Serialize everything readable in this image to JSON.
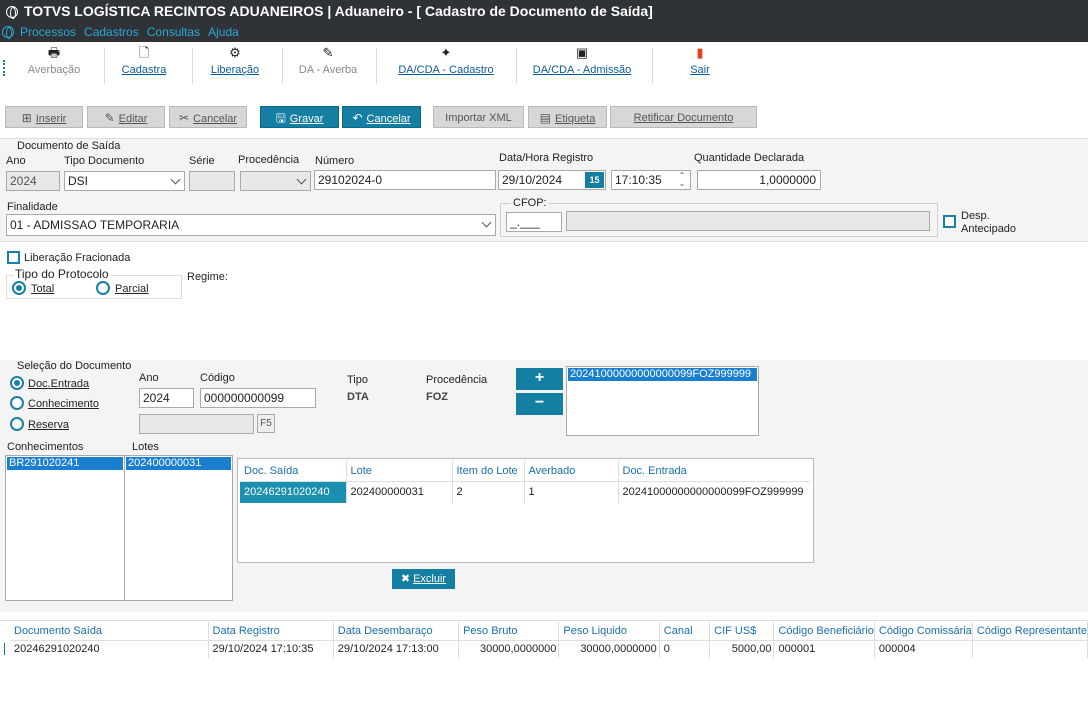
{
  "window": {
    "title": "TOTVS LOGÍSTICA RECINTOS ADUANEIROS | Aduaneiro - [ Cadastro de Documento de Saída]"
  },
  "menu": [
    "Processos",
    "Cadastros",
    "Consultas",
    "Ajuda"
  ],
  "toolbar": {
    "averbacao": "Averbação",
    "cadastra": "Cadastra",
    "liberacao": "Liberação",
    "da_averba": "DA - Averba",
    "dacda_cadastro": "DA/CDA - Cadastro",
    "dacda_admissao": "DA/CDA - Admissão",
    "sair": "Sair"
  },
  "actions": {
    "inserir": "Inserir",
    "editar": "Editar",
    "cancelar1": "Cancelar",
    "gravar": "Gravar",
    "cancelar2": "Cancelar",
    "importar_xml": "Importar XML",
    "etiqueta": "Etiqueta",
    "retificar": "Retificar Documento"
  },
  "doc_saida": {
    "section": "Documento de Saída",
    "ano_label": "Ano",
    "ano": "2024",
    "tipo_label": "Tipo Documento",
    "tipo": "DSI",
    "serie_label": "Série",
    "serie": "",
    "procedencia_label": "Procedência",
    "procedencia": "",
    "numero_label": "Número",
    "numero": "29102024-0",
    "datahora_label": "Data/Hora Registro",
    "data": "29/10/2024",
    "cal": "15",
    "hora": "17:10:35",
    "qtd_label": "Quantidade Declarada",
    "qtd": "1,0000000",
    "finalidade_label": "Finalidade",
    "finalidade": "01 - ADMISSAO TEMPORARIA",
    "cfop_label": "CFOP:",
    "cfop": "_.___",
    "cfop_desc": "",
    "desp_label": "Desp. Antecipado"
  },
  "liberacao": {
    "fracionada": "Liberação Fracionada",
    "tipo_protocolo": "Tipo do Protocolo",
    "total": "Total",
    "parcial": "Parcial",
    "regime": "Regime:"
  },
  "selecao": {
    "section": "Seleção do Documento",
    "doc_entrada": "Doc.Entrada",
    "conhecimento": "Conhecimento",
    "reserva": "Reserva",
    "ano_label": "Ano",
    "ano": "2024",
    "codigo_label": "Código",
    "codigo": "000000000099",
    "reserva_val": "",
    "f5": "F5",
    "tipo_label": "Tipo",
    "tipo": "DTA",
    "procedencia_label": "Procedência",
    "procedencia": "FOZ",
    "plus": "+",
    "minus": "−",
    "selected_doc": "20241000000000000099FOZ999999"
  },
  "conhecimentos": {
    "label": "Conhecimentos",
    "items": [
      "BR291020241"
    ]
  },
  "lotes": {
    "label": "Lotes",
    "items": [
      "202400000031"
    ]
  },
  "lote_grid": {
    "headers": [
      "Doc. Saída",
      "Lote",
      "Item do Lote",
      "Averbado",
      "Doc. Entrada"
    ],
    "rows": [
      [
        "20246291020240",
        "202400000031",
        "2",
        "1",
        "20241000000000000099FOZ999999"
      ]
    ],
    "excluir": "Excluir"
  },
  "bottom_grid": {
    "headers": [
      "Documento Saída",
      "Data Registro",
      "Data  Desembaraço",
      "Peso Bruto",
      "Peso Liquido",
      "Canal",
      "CIF US$",
      "Código Beneficiário",
      "Código Comissária",
      "Código Representante"
    ],
    "rows": [
      [
        "20246291020240",
        "29/10/2024 17:10:35",
        "29/10/2024 17:13:00",
        "30000,0000000",
        "30000,0000000",
        "0",
        "5000,00",
        "000001",
        "000004",
        ""
      ]
    ]
  }
}
